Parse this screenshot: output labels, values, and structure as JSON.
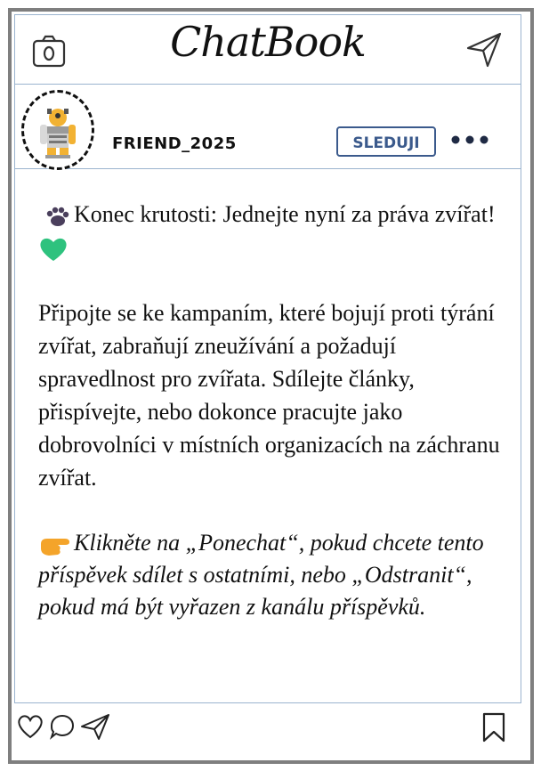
{
  "app": {
    "title": "ChatBook"
  },
  "profile": {
    "username": "FRIEND_2025",
    "follow_label": "SLEDUJI"
  },
  "post": {
    "headline": "Konec krutosti: Jednejte nyní za práva zvířat!",
    "body": "Připojte se ke kampaním, které bojují proti týrání zvířat, zabraňují zneužívání a požadují spravedlnost pro zvířata. Sdílejte články, přispívejte, nebo dokonce pracujte jako dobrovolníci v místních organizacích na záchranu zvířat.",
    "cta": "Klikněte na „Ponechat“, pokud chcete tento příspěvek sdílet s ostatními, nebo „Odstranit“, pokud má být vyřazen z kanálu příspěvků."
  },
  "icons": {
    "camera": "camera-icon",
    "send": "paper-plane-icon",
    "more": "more-dots-icon",
    "paw": "paw-icon",
    "heart_emoji": "green-heart-icon",
    "pointing": "pointing-hand-icon",
    "like": "heart-icon",
    "comment": "comment-icon",
    "share": "share-icon",
    "bookmark": "bookmark-icon"
  },
  "colors": {
    "border": "#7f7f7f",
    "divider": "#9bb4cf",
    "accent": "#3b5a8c"
  }
}
